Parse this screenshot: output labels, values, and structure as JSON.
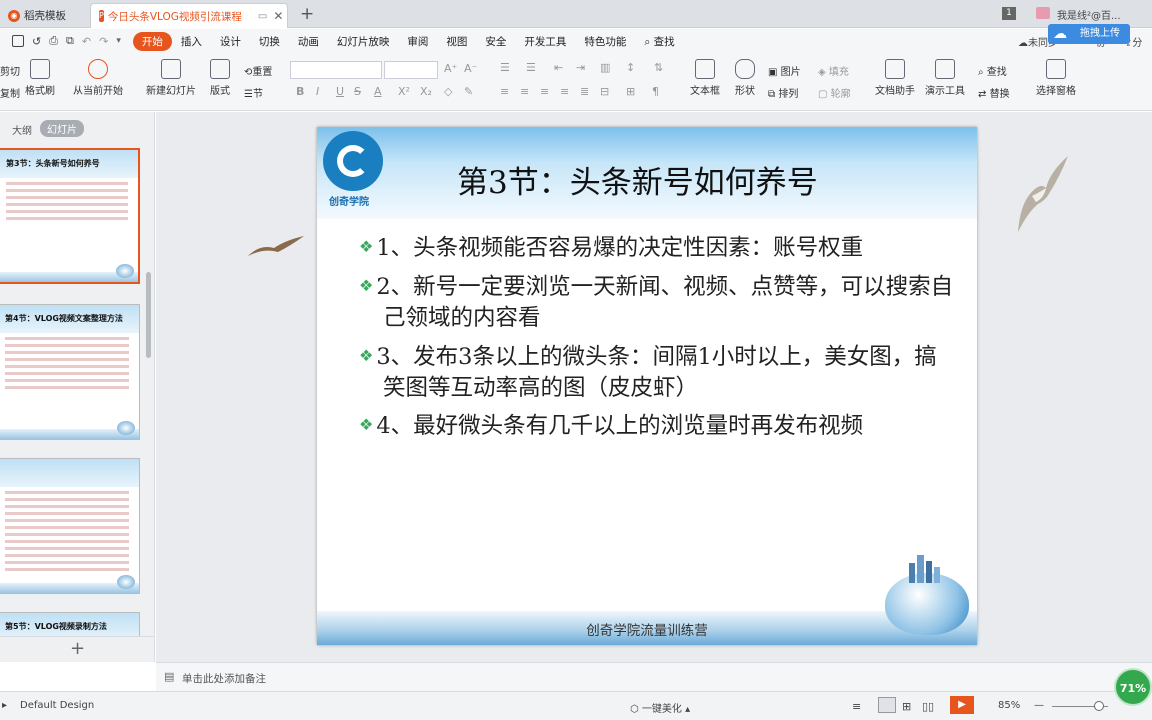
{
  "tabs": {
    "home_tab": "稻壳模板",
    "doc_tab": "今日头条VLOG视频引流课程",
    "doc_tab_badge": "P",
    "page_indicator": "1",
    "user_name": "我是线²@百..."
  },
  "menu": {
    "items": [
      "开始",
      "插入",
      "设计",
      "切换",
      "动画",
      "幻灯片放映",
      "审阅",
      "视图",
      "安全",
      "开发工具",
      "特色功能"
    ],
    "search": "查找",
    "unsynced": "未同步",
    "share_short": "分",
    "collab_short": "协",
    "upload_button": "拖拽上传"
  },
  "ribbon": {
    "cut": "剪切",
    "copy": "复制",
    "format_painter": "格式刷",
    "from_current": "从当前开始",
    "new_slide": "新建幻灯片",
    "layout": "版式",
    "reset": "重置",
    "section": "节",
    "text_box": "文本框",
    "shape": "形状",
    "picture": "图片",
    "fill": "填充",
    "arrange": "排列",
    "outline": "轮廓",
    "doc_assistant": "文档助手",
    "presentation_tools": "演示工具",
    "find": "查找",
    "replace": "替换",
    "selection_pane": "选择窗格",
    "font_glyphs": [
      "B",
      "I",
      "U",
      "S",
      "A",
      "X²",
      "X₂"
    ],
    "size_glyphs": [
      "A⁺",
      "A⁻"
    ]
  },
  "panel": {
    "outline_tab": "大纲",
    "slides_tab": "幻灯片",
    "add_slide": "+",
    "thumbs": [
      {
        "title": "第3节：头条新号如何养号",
        "lines": 6
      },
      {
        "title": "第4节：VLOG视频文案整理方法",
        "lines": 8
      },
      {
        "title": "",
        "lines": 12
      },
      {
        "title": "第5节：VLOG视频录制方法",
        "lines": 2
      }
    ]
  },
  "slide": {
    "title": "第3节：头条新号如何养号",
    "logo_text": "创奇学院",
    "bullets": [
      "1、头条视频能否容易爆的决定性因素：账号权重",
      "2、新号一定要浏览一天新闻、视频、点赞等，可以搜索自己领域的内容看",
      "3、发布3条以上的微头条：间隔1小时以上，美女图，搞笑图等互动率高的图（皮皮虾）",
      "4、最好微头条有几千以上的浏览量时再发布视频"
    ],
    "footer": "创奇学院流量训练营",
    "bullet_color": "#3aa85a"
  },
  "notes": {
    "placeholder": "单击此处添加备注"
  },
  "status": {
    "design_name": "Default Design",
    "beautify": "一键美化",
    "zoom": "85%",
    "zoom_badge": "71%"
  },
  "colors": {
    "accent": "#e8541e",
    "upload_blue": "#3d8be0",
    "badge_green": "#33a84c"
  }
}
